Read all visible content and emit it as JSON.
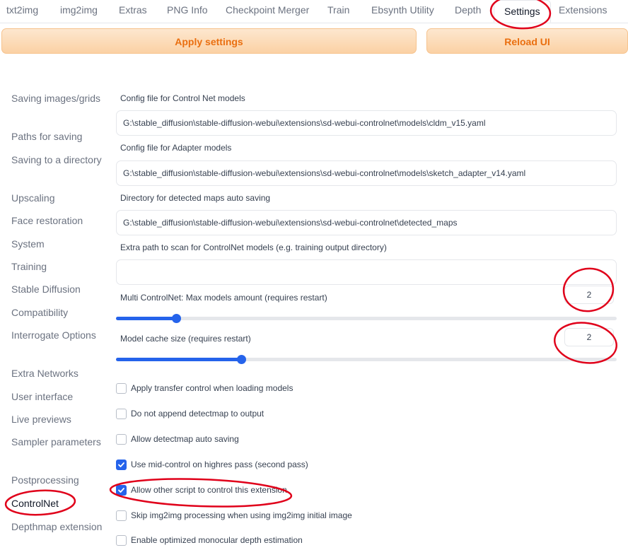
{
  "tabs": [
    "txt2img",
    "img2img",
    "Extras",
    "PNG Info",
    "Checkpoint Merger",
    "Train",
    "Ebsynth Utility",
    "Depth",
    "Settings",
    "Extensions"
  ],
  "buttons": {
    "apply": "Apply settings",
    "reload": "Reload UI"
  },
  "sidebar": [
    "Saving images/grids",
    "Paths for saving",
    "Saving to a directory",
    "Upscaling",
    "Face restoration",
    "System",
    "Training",
    "Stable Diffusion",
    "Compatibility",
    "Interrogate Options",
    "Extra Networks",
    "User interface",
    "Live previews",
    "Sampler parameters",
    "Postprocessing",
    "ControlNet",
    "Depthmap extension"
  ],
  "settings": {
    "config_controlnet_label": "Config file for Control Net models",
    "config_controlnet_value": "G:\\stable_diffusion\\stable-diffusion-webui\\extensions\\sd-webui-controlnet\\models\\cldm_v15.yaml",
    "config_adapter_label": "Config file for Adapter models",
    "config_adapter_value": "G:\\stable_diffusion\\stable-diffusion-webui\\extensions\\sd-webui-controlnet\\models\\sketch_adapter_v14.yaml",
    "detected_dir_label": "Directory for detected maps auto saving",
    "detected_dir_value": "G:\\stable_diffusion\\stable-diffusion-webui\\extensions\\sd-webui-controlnet\\detected_maps",
    "extra_path_label": "Extra path to scan for ControlNet models (e.g. training output directory)",
    "extra_path_value": "",
    "max_models_label": "Multi ControlNet: Max models amount (requires restart)",
    "max_models_value": "2",
    "max_models_fraction": 0.12,
    "cache_size_label": "Model cache size (requires restart)",
    "cache_size_value": "2",
    "cache_size_fraction": 0.25
  },
  "checkboxes": [
    {
      "label": "Apply transfer control when loading models",
      "checked": false
    },
    {
      "label": "Do not append detectmap to output",
      "checked": false
    },
    {
      "label": "Allow detectmap auto saving",
      "checked": false
    },
    {
      "label": "Use mid-control on highres pass (second pass)",
      "checked": true
    },
    {
      "label": "Allow other script to control this extension",
      "checked": true
    },
    {
      "label": "Skip img2img processing when using img2img initial image",
      "checked": false
    },
    {
      "label": "Enable optimized monocular depth estimation",
      "checked": false
    }
  ],
  "colors": {
    "accent": "#2563eb",
    "button_text": "#ea6f10",
    "annotation": "#e0001a"
  }
}
